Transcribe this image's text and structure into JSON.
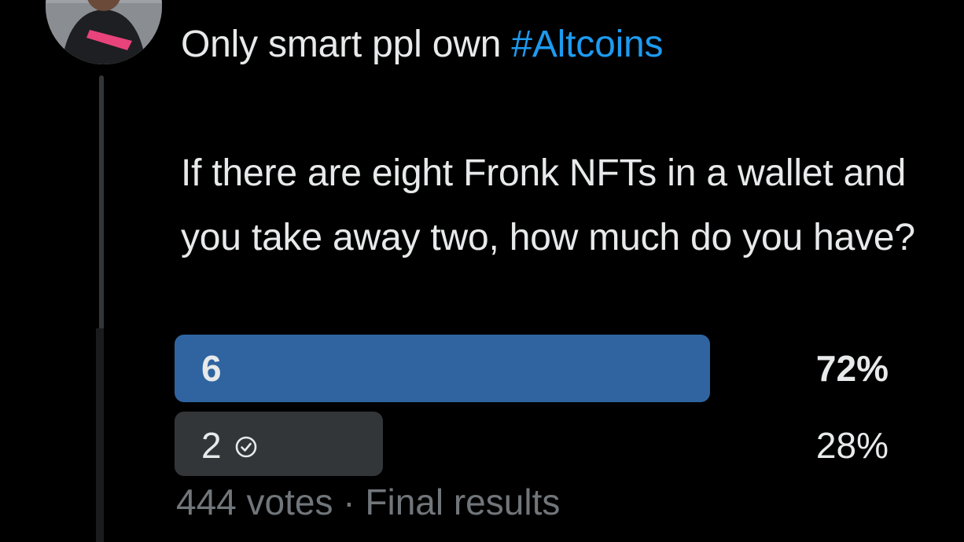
{
  "tweet": {
    "line1_prefix": "Only smart ppl own ",
    "hashtag": "#Altcoins",
    "question": "If there are eight Fronk NFTs in a wallet and you take away two, how much do you have?"
  },
  "poll": {
    "options": [
      {
        "label": "6",
        "percent_text": "72%",
        "fraction": 0.72,
        "winner": true
      },
      {
        "label": "2",
        "percent_text": "28%",
        "fraction": 0.28,
        "winner": false,
        "icon": "check-circle-icon"
      }
    ],
    "votes_text": "444 votes",
    "separator": "·",
    "status_text": "Final results"
  },
  "colors": {
    "background": "#000000",
    "text": "#e7e9ea",
    "hashtag": "#1d9bf0",
    "winner_bar": "#2f64a0",
    "loser_bar": "#333639",
    "muted": "#71767b"
  }
}
